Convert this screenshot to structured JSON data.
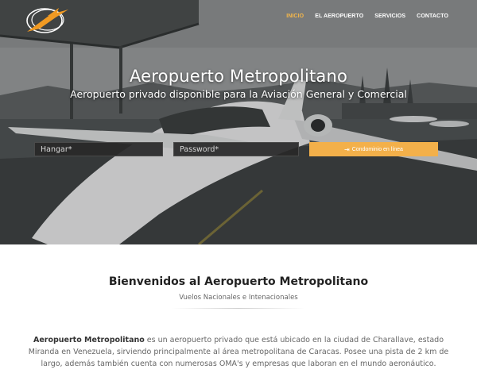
{
  "nav": {
    "items": [
      {
        "label": "INICIO",
        "active": true
      },
      {
        "label": "EL AEROPUERTO",
        "active": false
      },
      {
        "label": "SERVICIOS",
        "active": false
      },
      {
        "label": "CONTACTO",
        "active": false
      }
    ]
  },
  "hero": {
    "title": "Aeropuerto Metropolitano",
    "subtitle": "Aeropuerto privado disponible para la Aviación General y Comercial"
  },
  "login": {
    "hangar_placeholder": "Hangar*",
    "password_placeholder": "Password*",
    "button_label": "Condominio en línea",
    "button_icon": "sign-in-icon"
  },
  "content": {
    "welcome_title": "Bienvenidos al Aeropuerto Metropolitano",
    "tagline": "Vuelos Nacionales e Intenacionales",
    "desc_bold": "Aeropuerto Metropolitano",
    "desc_text": " es un aeropuerto privado que está ubicado en la ciudad de Charallave, estado Miranda en Venezuela, sirviendo principalmente al área metropolitana de Caracas. Posee una pista de 2 km de largo, además también cuenta con numerosas OMA's y empresas que laboran en el mundo aeronáutico."
  },
  "colors": {
    "accent": "#f3b04a",
    "nav_active": "#f5b74a"
  }
}
